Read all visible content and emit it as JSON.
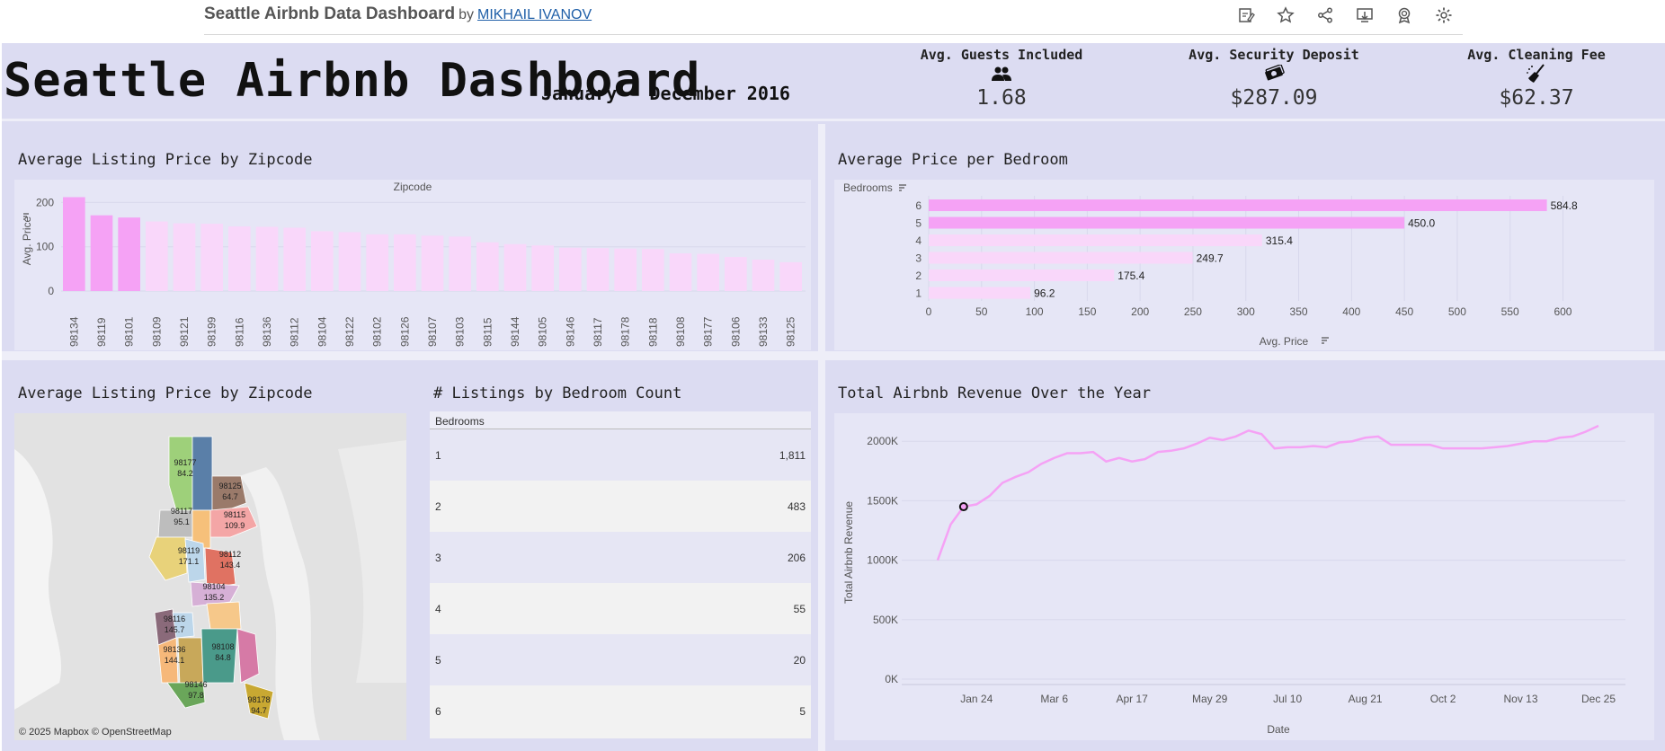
{
  "topbar": {
    "title": "Seattle Airbnb Data Dashboard",
    "by": "by",
    "author": "MIKHAIL IVANOV",
    "icons": [
      "edit-icon",
      "star-icon",
      "share-icon",
      "download-icon",
      "award-icon",
      "settings-icon"
    ]
  },
  "header": {
    "title": "Seattle Airbnb Dashboard",
    "date_range": "January - December 2016",
    "kpis": [
      {
        "label": "Avg. Guests Included",
        "icon": "people-icon",
        "value": "1.68"
      },
      {
        "label": "Avg. Security Deposit",
        "icon": "money-icon",
        "value": "$287.09"
      },
      {
        "label": "Avg. Cleaning Fee",
        "icon": "broom-icon",
        "value": "$62.37"
      }
    ]
  },
  "zip_bar": {
    "title": "Average Listing Price by Zipcode",
    "xheader": "Zipcode",
    "ylabel": "Avg. Price"
  },
  "bedroom_bar": {
    "title": "Average Price per Bedroom",
    "yheader": "Bedrooms",
    "xlabel": "Avg. Price"
  },
  "map": {
    "title": "Average Listing Price by Zipcode",
    "attribution": "© 2025 Mapbox  © OpenStreetMap",
    "labels": [
      {
        "zip": "98177",
        "value": "84.2"
      },
      {
        "zip": "98125",
        "value": "64.7"
      },
      {
        "zip": "98117",
        "value": "95.1"
      },
      {
        "zip": "98115",
        "value": "109.9"
      },
      {
        "zip": "98119",
        "value": "171.1"
      },
      {
        "zip": "98112",
        "value": "143.4"
      },
      {
        "zip": "98104",
        "value": "135.2"
      },
      {
        "zip": "98116",
        "value": "145.7"
      },
      {
        "zip": "98136",
        "value": "144.1"
      },
      {
        "zip": "98108",
        "value": "84.8"
      },
      {
        "zip": "98146",
        "value": "97.8"
      },
      {
        "zip": "98178",
        "value": "94.7"
      }
    ]
  },
  "table": {
    "title": "# Listings by Bedroom Count",
    "header": "Bedrooms",
    "rows": [
      {
        "bedrooms": "1",
        "count": "1,811"
      },
      {
        "bedrooms": "2",
        "count": "483"
      },
      {
        "bedrooms": "3",
        "count": "206"
      },
      {
        "bedrooms": "4",
        "count": "55"
      },
      {
        "bedrooms": "5",
        "count": "20"
      },
      {
        "bedrooms": "6",
        "count": "5"
      }
    ]
  },
  "revenue": {
    "title": "Total Airbnb Revenue Over the Year",
    "xlabel": "Date",
    "ylabel": "Total Airbnb Revenue"
  },
  "colors": {
    "bar_highlight": "#f5a2f5",
    "bar_faded": "#f9d7fa",
    "line": "#f5a2f5",
    "background": "#dcdcf2"
  },
  "chart_data": [
    {
      "type": "bar",
      "title": "Average Listing Price by Zipcode",
      "xlabel": "Zipcode",
      "ylabel": "Avg. Price",
      "categories": [
        "98134",
        "98119",
        "98101",
        "98109",
        "98121",
        "98199",
        "98116",
        "98136",
        "98112",
        "98104",
        "98122",
        "98102",
        "98126",
        "98107",
        "98103",
        "98115",
        "98144",
        "98105",
        "98146",
        "98117",
        "98178",
        "98118",
        "98108",
        "98177",
        "98106",
        "98133",
        "98125"
      ],
      "values": [
        212,
        171,
        166,
        157,
        153,
        152,
        146,
        145,
        143,
        135,
        133,
        128,
        128,
        125,
        123,
        110,
        106,
        103,
        98,
        97,
        96,
        95,
        85,
        84,
        77,
        71,
        65
      ],
      "highlighted": [
        "98134",
        "98119",
        "98101"
      ],
      "yticks": [
        0,
        100,
        200
      ],
      "ylim": [
        0,
        215
      ]
    },
    {
      "type": "bar",
      "orientation": "horizontal",
      "title": "Average Price per Bedroom",
      "xlabel": "Avg. Price",
      "ylabel": "Bedrooms",
      "categories": [
        "6",
        "5",
        "4",
        "3",
        "2",
        "1"
      ],
      "values": [
        584.8,
        450.0,
        315.4,
        249.7,
        175.4,
        96.2
      ],
      "value_labels": [
        "584.8",
        "450.0",
        "315.4",
        "249.7",
        "175.4",
        "96.2"
      ],
      "highlighted": [
        "6",
        "5"
      ],
      "xticks": [
        0,
        50,
        100,
        150,
        200,
        250,
        300,
        350,
        400,
        450,
        500,
        550,
        600
      ],
      "xlim": [
        0,
        620
      ]
    },
    {
      "type": "line",
      "title": "Total Airbnb Revenue Over the Year",
      "xlabel": "Date",
      "ylabel": "Total Airbnb Revenue",
      "xticks": [
        "Jan 24",
        "Mar 6",
        "Apr 17",
        "May 29",
        "Jul 10",
        "Aug 21",
        "Oct 2",
        "Nov 13",
        "Dec 25"
      ],
      "yticks": [
        "0K",
        "500K",
        "1000K",
        "1500K",
        "2000K"
      ],
      "ylim": [
        0,
        2130000
      ],
      "x_weeks": [
        0,
        1,
        2,
        3,
        4,
        5,
        6,
        7,
        8,
        9,
        10,
        11,
        12,
        13,
        14,
        15,
        16,
        17,
        18,
        19,
        20,
        21,
        22,
        23,
        24,
        25,
        26,
        27,
        28,
        29,
        30,
        31,
        32,
        33,
        34,
        35,
        36,
        37,
        38,
        39,
        40,
        41,
        42,
        43,
        44,
        45,
        46,
        47,
        48,
        49,
        50,
        51
      ],
      "values": [
        1000000,
        1300000,
        1450000,
        1470000,
        1540000,
        1650000,
        1700000,
        1740000,
        1810000,
        1860000,
        1900000,
        1900000,
        1910000,
        1830000,
        1860000,
        1830000,
        1850000,
        1910000,
        1920000,
        1940000,
        1980000,
        2030000,
        2010000,
        2040000,
        2090000,
        2060000,
        1940000,
        1950000,
        1950000,
        1960000,
        1950000,
        1990000,
        2000000,
        2030000,
        2040000,
        1970000,
        1970000,
        1970000,
        1970000,
        1940000,
        1940000,
        1940000,
        1940000,
        1950000,
        1960000,
        1980000,
        2000000,
        2000000,
        2030000,
        2040000,
        2080000,
        2130000
      ],
      "highlighted_point": {
        "x": 2,
        "y": 1450000
      }
    }
  ]
}
